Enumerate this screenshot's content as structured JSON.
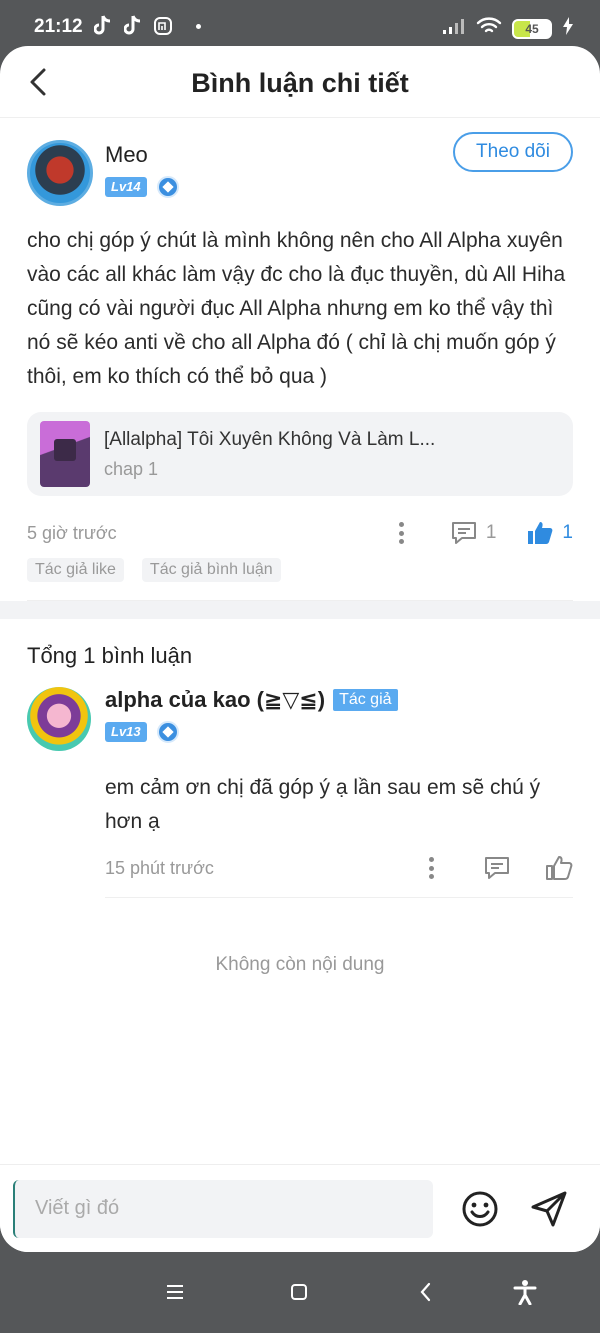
{
  "status_bar": {
    "time": "21:12",
    "battery": "45",
    "icons": [
      "tiktok-icon",
      "tiktok-icon",
      "mi-icon",
      "signal-icon",
      "wifi-icon",
      "battery-icon",
      "charging-icon"
    ]
  },
  "header": {
    "title": "Bình luận chi tiết"
  },
  "post": {
    "author": "Meo",
    "level": "Lv14",
    "follow_label": "Theo dõi",
    "text": "cho chị góp ý chút là mình không nên cho All Alpha xuyên vào các all khác làm vậy đc cho là đục thuyền, dù All Hiha cũng có vài người đục All Alpha nhưng em ko thể vậy thì nó sẽ kéo anti về cho all Alpha đó ( chỉ là chị muốn góp ý thôi, em ko thích có thể bỏ qua )",
    "linked": {
      "title": "[Allalpha] Tôi Xuyên Không Và Làm L...",
      "subtitle": "chap 1"
    },
    "time": "5 giờ trước",
    "comment_count": "1",
    "like_count": "1",
    "tags": [
      "Tác giả like",
      "Tác giả bình luận"
    ]
  },
  "replies": {
    "total_label": "Tổng 1 bình luận",
    "items": [
      {
        "author": "alpha của kao (≧▽≦)",
        "badge": "Tác giả",
        "level": "Lv13",
        "text": "em cảm ơn chị đã góp ý ạ lần sau em sẽ chú ý hơn ạ",
        "time": "15 phút trước"
      }
    ],
    "end_label": "Không còn nội dung"
  },
  "compose": {
    "placeholder": "Viết gì đó"
  },
  "colors": {
    "accent": "#2f8be0",
    "badge": "#5aaaf0",
    "muted": "#999999",
    "background_outer": "#555759"
  }
}
